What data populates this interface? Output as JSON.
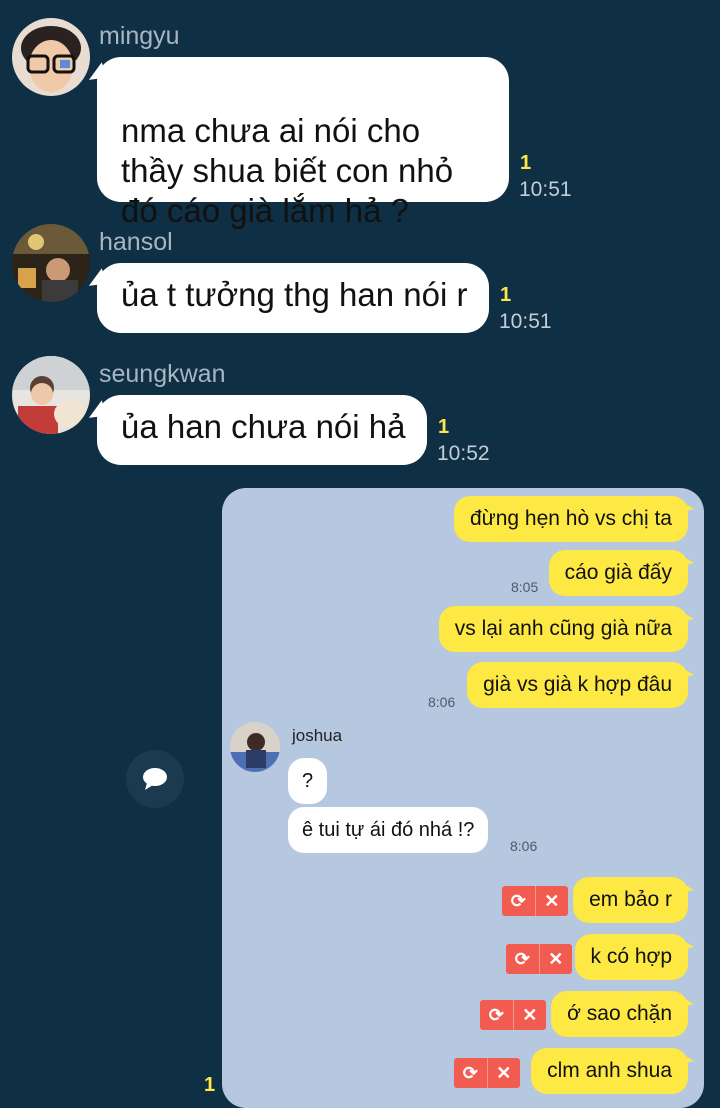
{
  "messages": [
    {
      "sender": "mingyu",
      "text": "nma chưa ai nói cho\nthầy shua biết con nhỏ\nđó cáo già lắm hả ?",
      "unread": "1",
      "time": "10:51"
    },
    {
      "sender": "hansol",
      "text": "ủa t tưởng thg han nói r",
      "unread": "1",
      "time": "10:51"
    },
    {
      "sender": "seungkwan",
      "text": "ủa han chưa nói hả",
      "unread": "1",
      "time": "10:52"
    }
  ],
  "screenshot": {
    "outgoing_1": [
      "đừng hẹn hò vs chị ta",
      "cáo già đấy"
    ],
    "time_1": "8:05",
    "outgoing_2": [
      "vs lại anh cũng già nữa",
      "già vs già k hợp đâu"
    ],
    "time_2": "8:06",
    "incoming_sender": "joshua",
    "incoming": [
      "?",
      "ê tui tự ái đó nhá !?"
    ],
    "time_3": "8:06",
    "failed": [
      "em bảo r",
      "k có hợp",
      "ớ sao chặn",
      "clm anh shua"
    ]
  },
  "trailing_unread": "1",
  "colors": {
    "background": "#0f2f45",
    "bubble": "#ffffff",
    "unread": "#ffe74a",
    "my_bubble": "#fde844",
    "failed": "#f25c50"
  }
}
